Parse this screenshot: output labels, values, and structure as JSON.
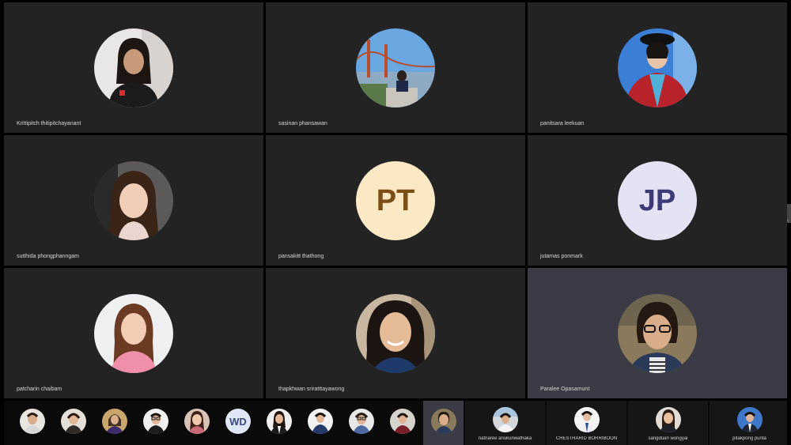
{
  "grid": {
    "tiles": [
      {
        "name": "Krittipitch thitipitchayanant",
        "initials": ""
      },
      {
        "name": "sasinan phansawan",
        "initials": ""
      },
      {
        "name": "panitsara leekuan",
        "initials": ""
      },
      {
        "name": "sutthida phongphanngam",
        "initials": ""
      },
      {
        "name": "pansakitt thathong",
        "initials": "PT",
        "avatar_bg": "#fbe9c6",
        "avatar_fg": "#7a4e14"
      },
      {
        "name": "jutamas ponmark",
        "initials": "JP",
        "avatar_bg": "#e4e3f4",
        "avatar_fg": "#3d3a78"
      },
      {
        "name": "patcharin chaibam",
        "initials": ""
      },
      {
        "name": "thapkhwan sriratttayawong",
        "initials": ""
      },
      {
        "name": "Paralee Opasamunt",
        "initials": ""
      }
    ],
    "active_tile_color": "#3a3b44"
  },
  "strip": {
    "thumb_initials": "WD",
    "named": [
      {
        "name": "natnaree anukunwathaka"
      },
      {
        "name": "CHESTHARID BORRIBOON"
      },
      {
        "name": "sangduan wongyai"
      },
      {
        "name": "pitakpong punta"
      }
    ]
  }
}
